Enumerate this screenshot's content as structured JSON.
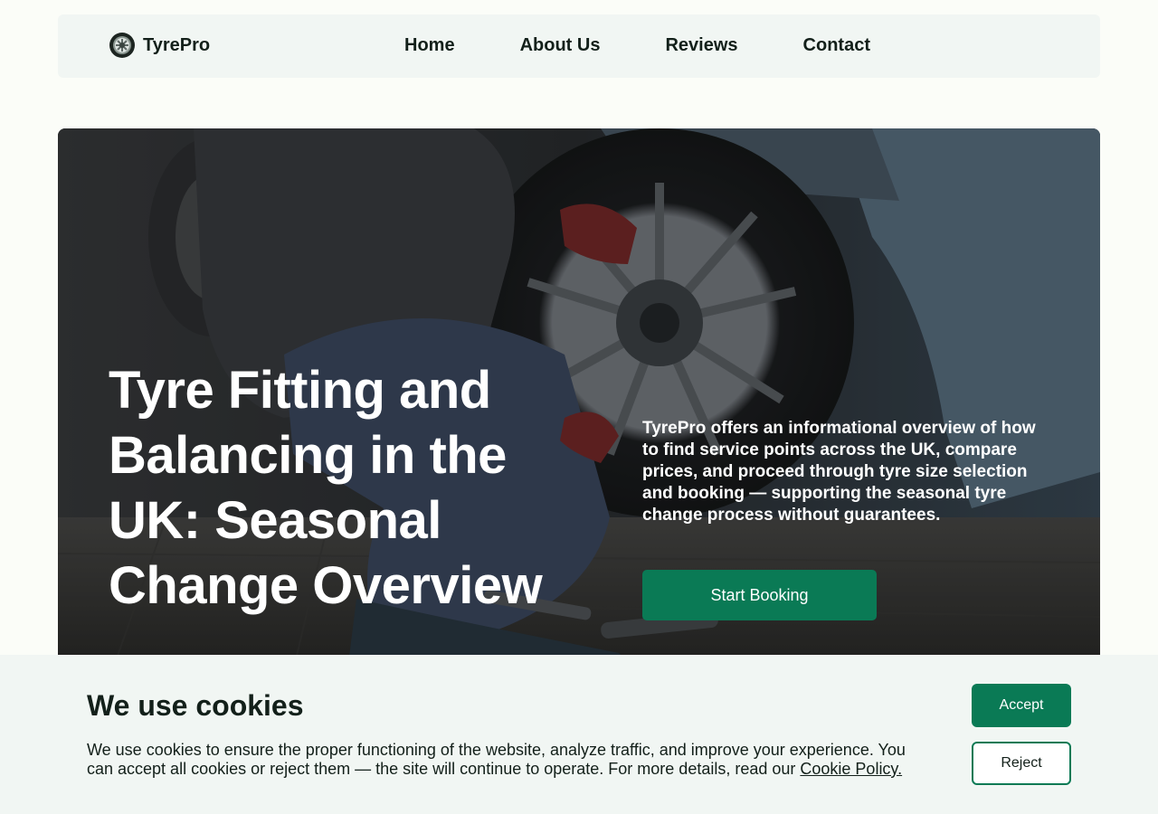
{
  "brand": {
    "name": "TyrePro",
    "logo_icon": "tyre-logo-icon"
  },
  "nav": {
    "items": [
      {
        "label": "Home"
      },
      {
        "label": "About Us"
      },
      {
        "label": "Reviews"
      },
      {
        "label": "Contact"
      }
    ]
  },
  "hero": {
    "title": "Tyre Fitting and Balancing in the UK: Seasonal Change Overview",
    "description": "TyrePro offers an informational overview of how to find service points across the UK, compare prices, and proceed through tyre size selection and booking — supporting the seasonal tyre change process without guarantees.",
    "cta_label": "Start Booking"
  },
  "cookie_banner": {
    "title": "We use cookies",
    "text": "We use cookies to ensure the proper functioning of the website, analyze traffic, and improve your experience. You can accept all cookies or reject them — the site will continue to operate. For more details, read our ",
    "link_label": "Cookie Policy.",
    "accept_label": "Accept",
    "reject_label": "Reject"
  },
  "colors": {
    "accent": "#0a7a55",
    "header_bg": "#f1f6f3",
    "page_bg": "#fbfdf8",
    "text": "#13201a"
  }
}
